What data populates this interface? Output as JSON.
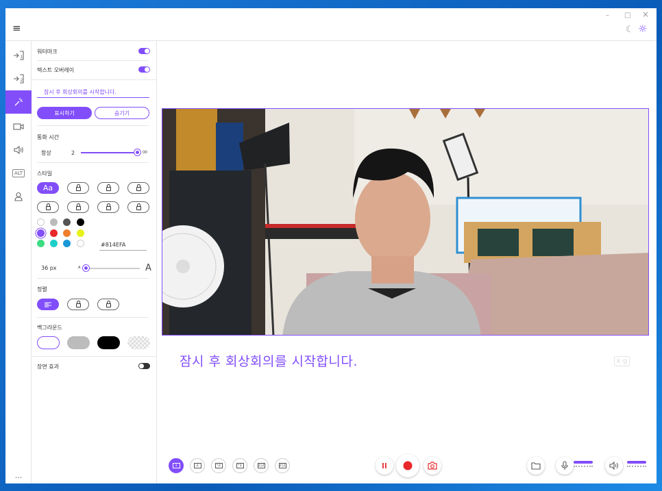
{
  "titlebar": {
    "menu_icon": "≡",
    "minimize": "–",
    "maximize": "□",
    "close": "×",
    "moon_icon": "☾",
    "sun_icon": "☼"
  },
  "rail": {
    "items": [
      {
        "name": "input-1-icon",
        "glyph": "⇥1"
      },
      {
        "name": "input-2-icon",
        "glyph": "⇥2"
      },
      {
        "name": "magic-wand-icon",
        "glyph": "✧"
      },
      {
        "name": "camera-icon",
        "glyph": "▭"
      },
      {
        "name": "speaker-icon",
        "glyph": "◁)"
      },
      {
        "name": "alt-text-icon",
        "glyph": "ALT"
      },
      {
        "name": "user-icon",
        "glyph": "♙"
      }
    ],
    "more": "···"
  },
  "panel": {
    "watermark_label": "워터마크",
    "text_overlay_label": "텍스트 오버레이",
    "overlay_input": "잠시 후 회상회의를 시작합니다.",
    "show_button": "표시하기",
    "hide_button": "숨기기",
    "duration_label": "통화 시간",
    "duration_sub": "항상",
    "duration_value": "2",
    "duration_max": "∞",
    "style_label": "스타일",
    "style_selected": "Aa",
    "hex_value": "#814EFA",
    "font_size": "36 px",
    "font_small": "A",
    "font_large": "A",
    "align_label": "정렬",
    "background_label": "백그라운드",
    "transition_label": "장면 효과"
  },
  "colors": {
    "accent": "#814EFA",
    "swatches": [
      "#ffffff",
      "#bbbbbb",
      "#555555",
      "#000000",
      "#814EFA",
      "#e8282a",
      "#f07e2c",
      "#e6f21a",
      "#3ddc84",
      "#1ecfc9",
      "#1a97d8",
      "#ffffff"
    ]
  },
  "main": {
    "overlay_text": "잠시 후 회상회의를 시작합니다.",
    "watermark_glyph": "k·g",
    "layouts": [
      "1",
      "2",
      "¹2",
      "¹1",
      "1|2",
      "2|1"
    ]
  }
}
